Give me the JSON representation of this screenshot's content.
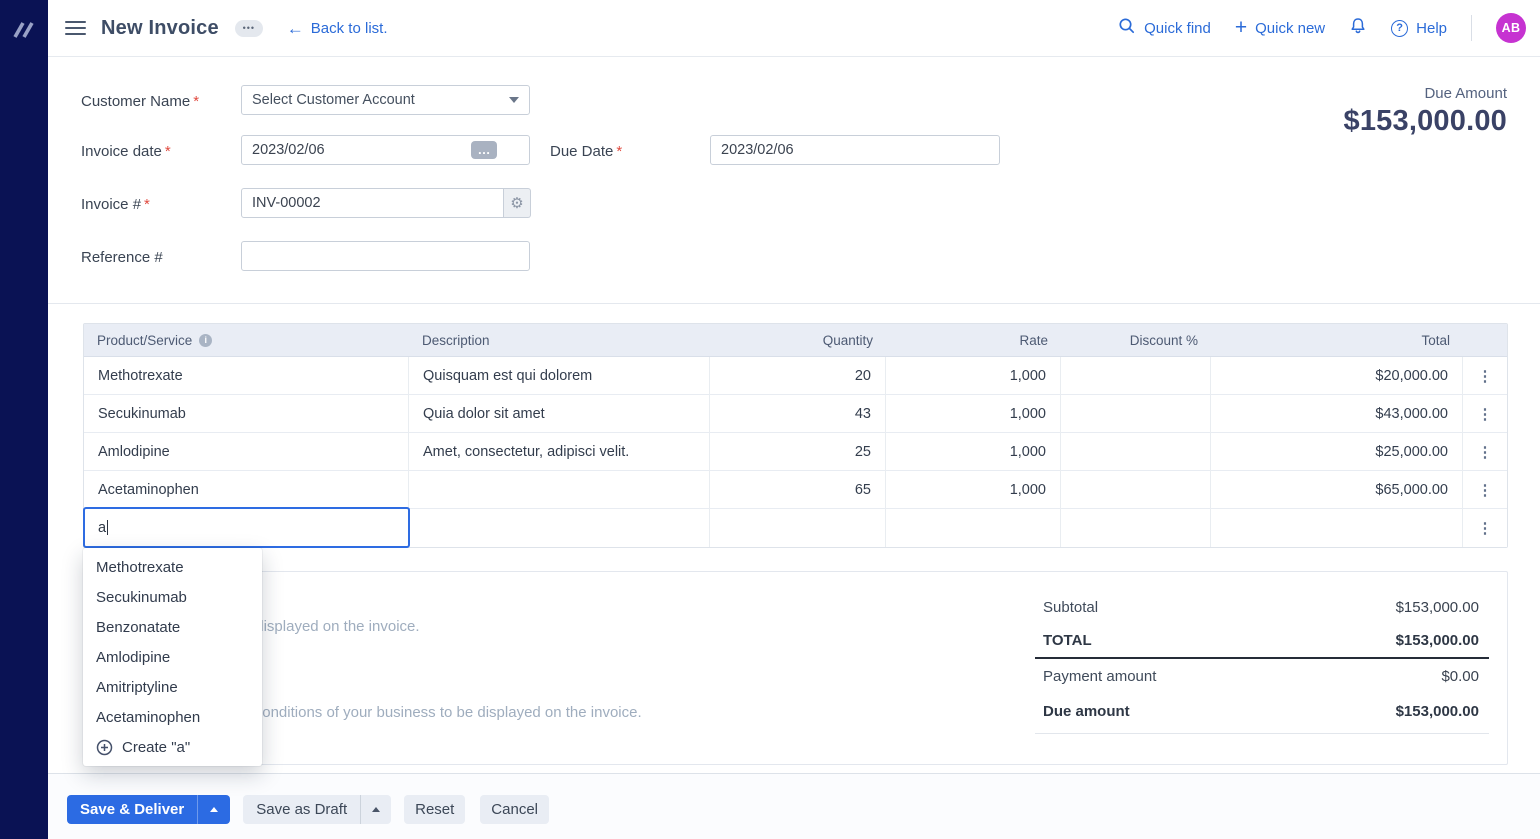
{
  "colors": {
    "accent_blue": "#2c6be3",
    "link_blue": "#2b6bd8",
    "sidebar_navy": "#0a1254",
    "avatar_magenta": "#c633d1",
    "table_header_bg": "#e9edf5",
    "due_amount_text": "#3a4266"
  },
  "topbar": {
    "title": "New Invoice",
    "more_dots": "•••",
    "back_arrow": "←",
    "back_label": "Back to list.",
    "quick_find_label": "Quick find",
    "quick_new_plus": "+",
    "quick_new_label": "Quick new",
    "help_glyph": "?",
    "help_label": "Help",
    "avatar_initials": "AB"
  },
  "form": {
    "required_marker": "*",
    "customer_name": {
      "label": "Customer Name",
      "placeholder": "Select Customer Account"
    },
    "invoice_date": {
      "label": "Invoice date",
      "value": "2023/02/06"
    },
    "due_date": {
      "label": "Due Date",
      "value": "2023/02/06"
    },
    "invoice_number": {
      "label": "Invoice #",
      "value": "INV-00002"
    },
    "reference_number": {
      "label": "Reference #",
      "value": ""
    },
    "due_amount_label": "Due Amount",
    "due_amount_value": "$153,000.00",
    "date_picker_dots": "…",
    "gear_glyph": "⚙"
  },
  "table": {
    "headers": {
      "product": "Product/Service",
      "description": "Description",
      "quantity": "Quantity",
      "rate": "Rate",
      "discount": "Discount %",
      "total": "Total"
    },
    "info_icon_glyph": "i",
    "kebab_glyph": "⋮",
    "rows": [
      {
        "product": "Methotrexate",
        "description": "Quisquam est qui dolorem",
        "quantity": "20",
        "rate": "1,000",
        "discount": "",
        "total": "$20,000.00"
      },
      {
        "product": "Secukinumab",
        "description": "Quia dolor sit amet",
        "quantity": "43",
        "rate": "1,000",
        "discount": "",
        "total": "$43,000.00"
      },
      {
        "product": "Amlodipine",
        "description": "Amet, consectetur, adipisci velit.",
        "quantity": "25",
        "rate": "1,000",
        "discount": "",
        "total": "$25,000.00"
      },
      {
        "product": "Acetaminophen",
        "description": "",
        "quantity": "65",
        "rate": "1,000",
        "discount": "",
        "total": "$65,000.00"
      }
    ],
    "new_row": {
      "value": "a"
    }
  },
  "product_dropdown": {
    "items": [
      "Methotrexate",
      "Secukinumab",
      "Benzonatate",
      "Amlodipine",
      "Amitriptyline",
      "Acetaminophen"
    ],
    "create_label": "Create \"a\""
  },
  "notes": {
    "customer_notes_placeholder": "Add a note to be displayed on the invoice.",
    "terms_placeholder": "Add the terms and conditions of your business to be displayed on the invoice."
  },
  "totals": {
    "subtotal": {
      "label": "Subtotal",
      "value": "$153,000.00"
    },
    "total": {
      "label": "TOTAL",
      "value": "$153,000.00"
    },
    "payment": {
      "label": "Payment amount",
      "value": "$0.00"
    },
    "due": {
      "label": "Due amount",
      "value": "$153,000.00"
    }
  },
  "footer": {
    "save_deliver_label": "Save & Deliver",
    "save_draft_label": "Save as Draft",
    "reset_label": "Reset",
    "cancel_label": "Cancel"
  }
}
